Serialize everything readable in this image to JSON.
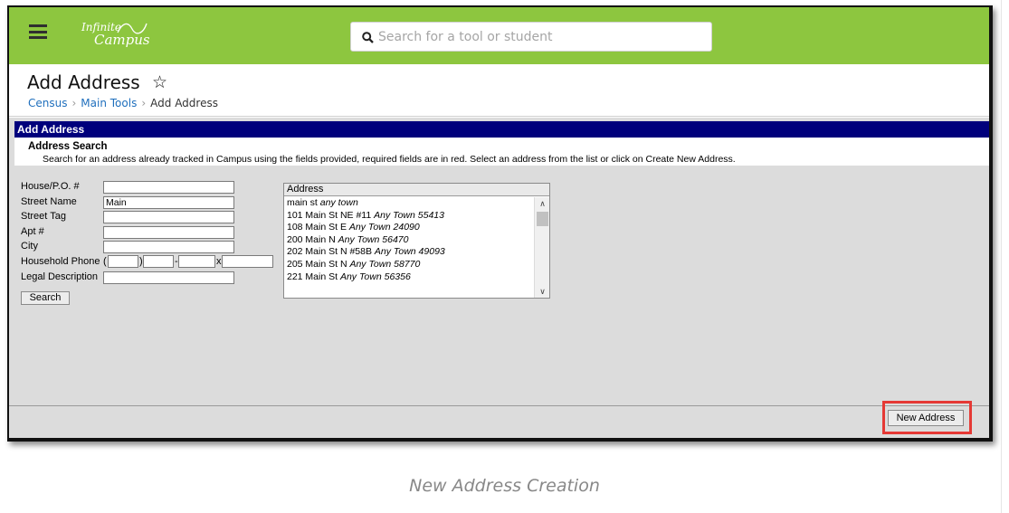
{
  "header": {
    "logo_line1": "Infinite",
    "logo_line2": "Campus",
    "search_placeholder": "Search for a tool or student",
    "accent_color": "#8dc63f"
  },
  "page": {
    "title": "Add Address",
    "breadcrumb": [
      "Census",
      "Main Tools",
      "Add Address"
    ]
  },
  "panel": {
    "header": "Add Address",
    "search_title": "Address Search",
    "search_desc": "Search for an address already tracked in Campus using the fields provided, required fields are in red. Select an address from the list or click on Create New Address.",
    "header_color": "#00007c"
  },
  "form": {
    "fields": [
      {
        "label": "House/P.O. #",
        "value": ""
      },
      {
        "label": "Street Name",
        "value": "Main"
      },
      {
        "label": "Street Tag",
        "value": ""
      },
      {
        "label": "Apt #",
        "value": ""
      },
      {
        "label": "City",
        "value": ""
      },
      {
        "label": "Household Phone",
        "value": ""
      },
      {
        "label": "Legal Description",
        "value": ""
      }
    ],
    "phone_sep_open": "(",
    "phone_sep_close": ")",
    "phone_sep_dash": "-",
    "phone_sep_ext": "x",
    "search_button": "Search"
  },
  "address_list": {
    "header": "Address",
    "items": [
      {
        "street": "main st",
        "town": "any town"
      },
      {
        "street": "101 Main St NE #11",
        "town": "Any Town 55413"
      },
      {
        "street": "108 Main St E",
        "town": "Any Town 24090"
      },
      {
        "street": "200 Main N",
        "town": "Any Town 56470"
      },
      {
        "street": "202 Main St N #58B",
        "town": "Any Town 49093"
      },
      {
        "street": "205 Main St N",
        "town": "Any Town 58770"
      },
      {
        "street": "221 Main St",
        "town": "Any Town 56356"
      }
    ]
  },
  "footer": {
    "new_address_button": "New Address",
    "highlight_color": "#e53935"
  },
  "caption": "New Address Creation"
}
